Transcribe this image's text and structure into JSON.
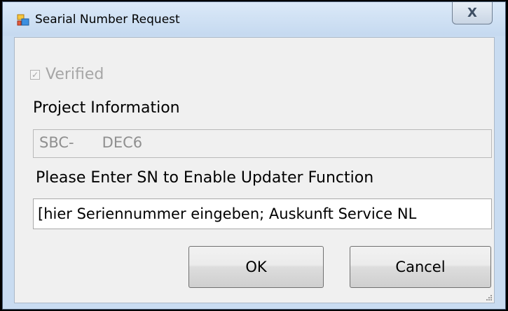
{
  "window": {
    "title": "Searial Number Request",
    "close_label": "X"
  },
  "checkbox": {
    "label": "Verified",
    "checked": true,
    "enabled": false
  },
  "project": {
    "label": "Project Information",
    "value": "SBC-      DEC6"
  },
  "serial": {
    "label": "Please Enter SN to Enable Updater Function",
    "value": "[hier Seriennummer eingeben; Auskunft Service NL"
  },
  "buttons": {
    "ok_label": "OK",
    "cancel_label": "Cancel"
  },
  "icons": {
    "app": "application-window-icon",
    "close": "close-icon",
    "grip": "resize-grip-icon"
  },
  "colors": {
    "titlebar": "#c9dcf1",
    "client_background": "#f0f0f0",
    "disabled_text": "#a6a6a6"
  }
}
